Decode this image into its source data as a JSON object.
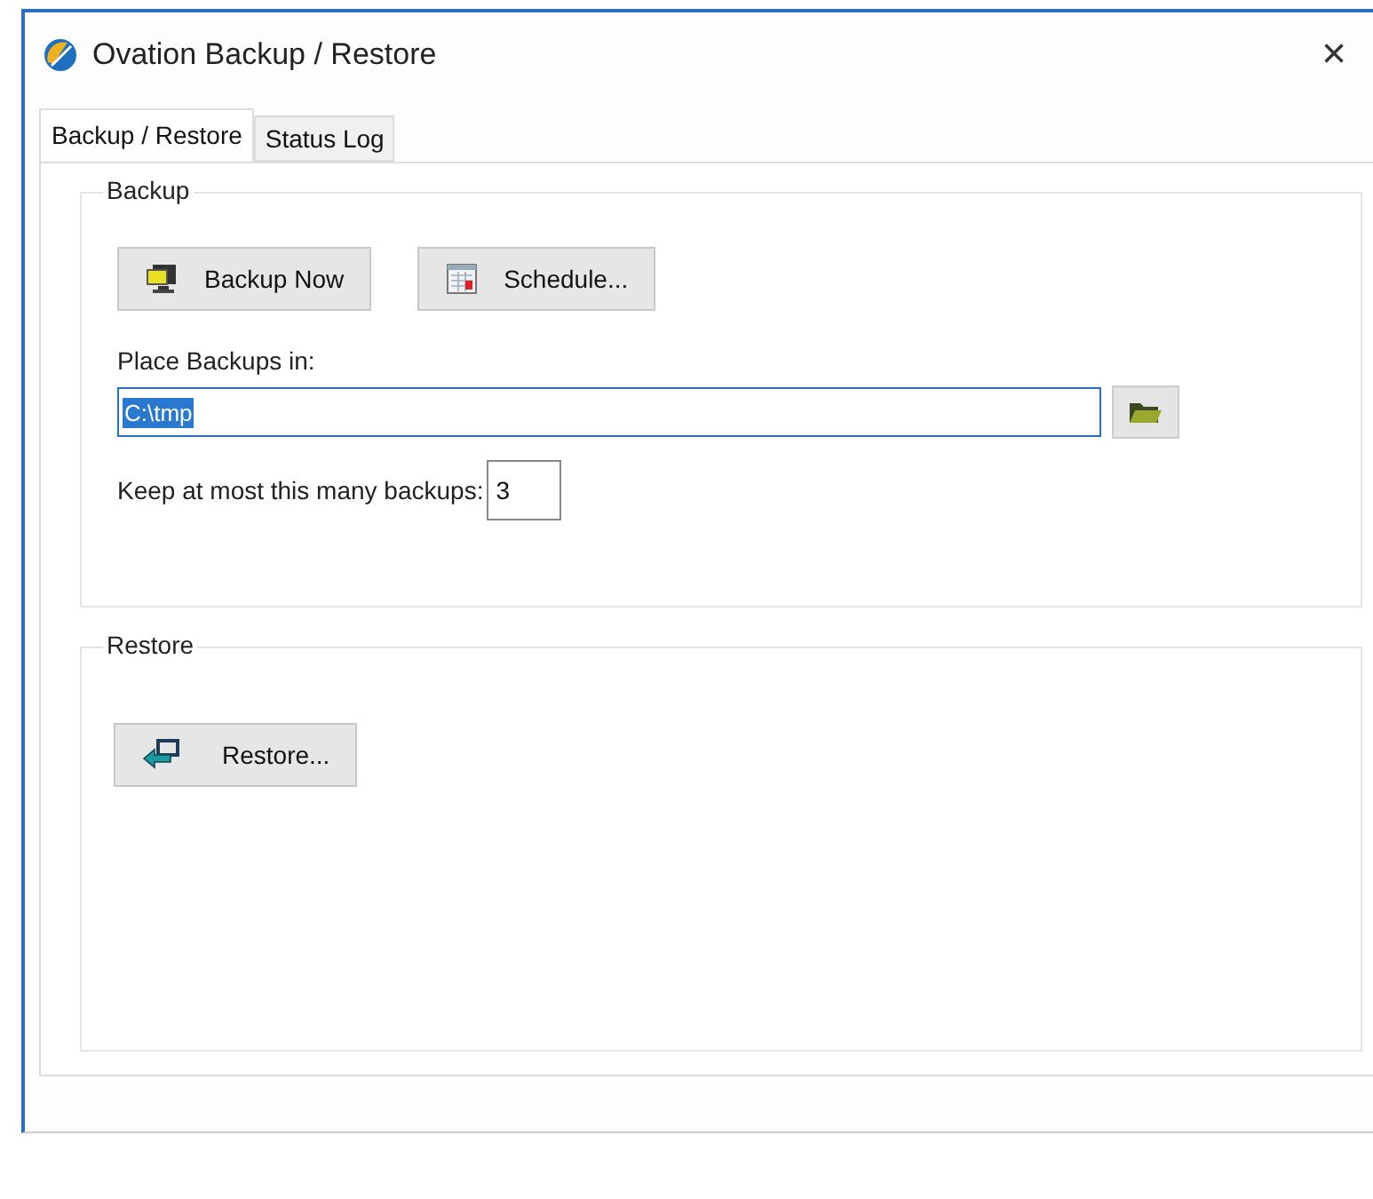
{
  "window": {
    "title": "Ovation Backup / Restore",
    "close": "×"
  },
  "tabs": [
    {
      "label": "Backup / Restore",
      "selected": true
    },
    {
      "label": "Status Log",
      "selected": false
    }
  ],
  "backup": {
    "title": "Backup",
    "buttons": [
      {
        "label": "Backup Now",
        "kind": "backup"
      },
      {
        "label": "Schedule...",
        "kind": "schedule"
      }
    ],
    "location_label": "Place Backups in:",
    "location": {
      "value": "C:\\tmp",
      "text_selected": true
    },
    "keep_label": "Keep at most this many backups:",
    "keep": {
      "value": "3"
    }
  },
  "restore": {
    "title": "Restore",
    "button": {
      "label": "Restore...",
      "kind": "restore"
    }
  }
}
